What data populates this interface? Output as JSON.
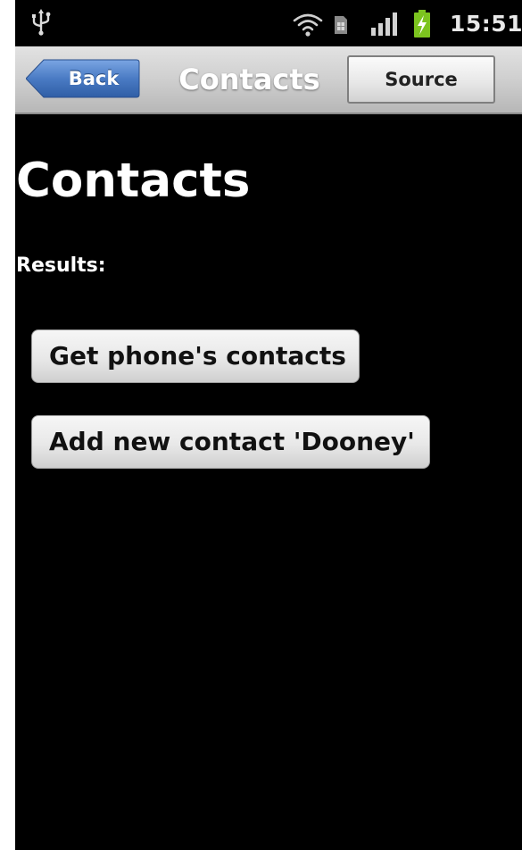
{
  "status_bar": {
    "time": "15:51",
    "icons": [
      "usb-icon",
      "wifi-icon",
      "sim-card-icon",
      "signal-icon",
      "battery-charging-icon"
    ]
  },
  "nav_bar": {
    "back_label": "Back",
    "title": "Contacts",
    "source_label": "Source"
  },
  "content": {
    "heading": "Contacts",
    "results_label": "Results:",
    "buttons": [
      {
        "label": "Get phone's contacts"
      },
      {
        "label": "Add new contact 'Dooney'"
      }
    ]
  },
  "colors": {
    "background": "#000000",
    "back_button": "#4a7bc4",
    "battery_fill": "#7cc41f",
    "title_text": "#ffffff"
  }
}
